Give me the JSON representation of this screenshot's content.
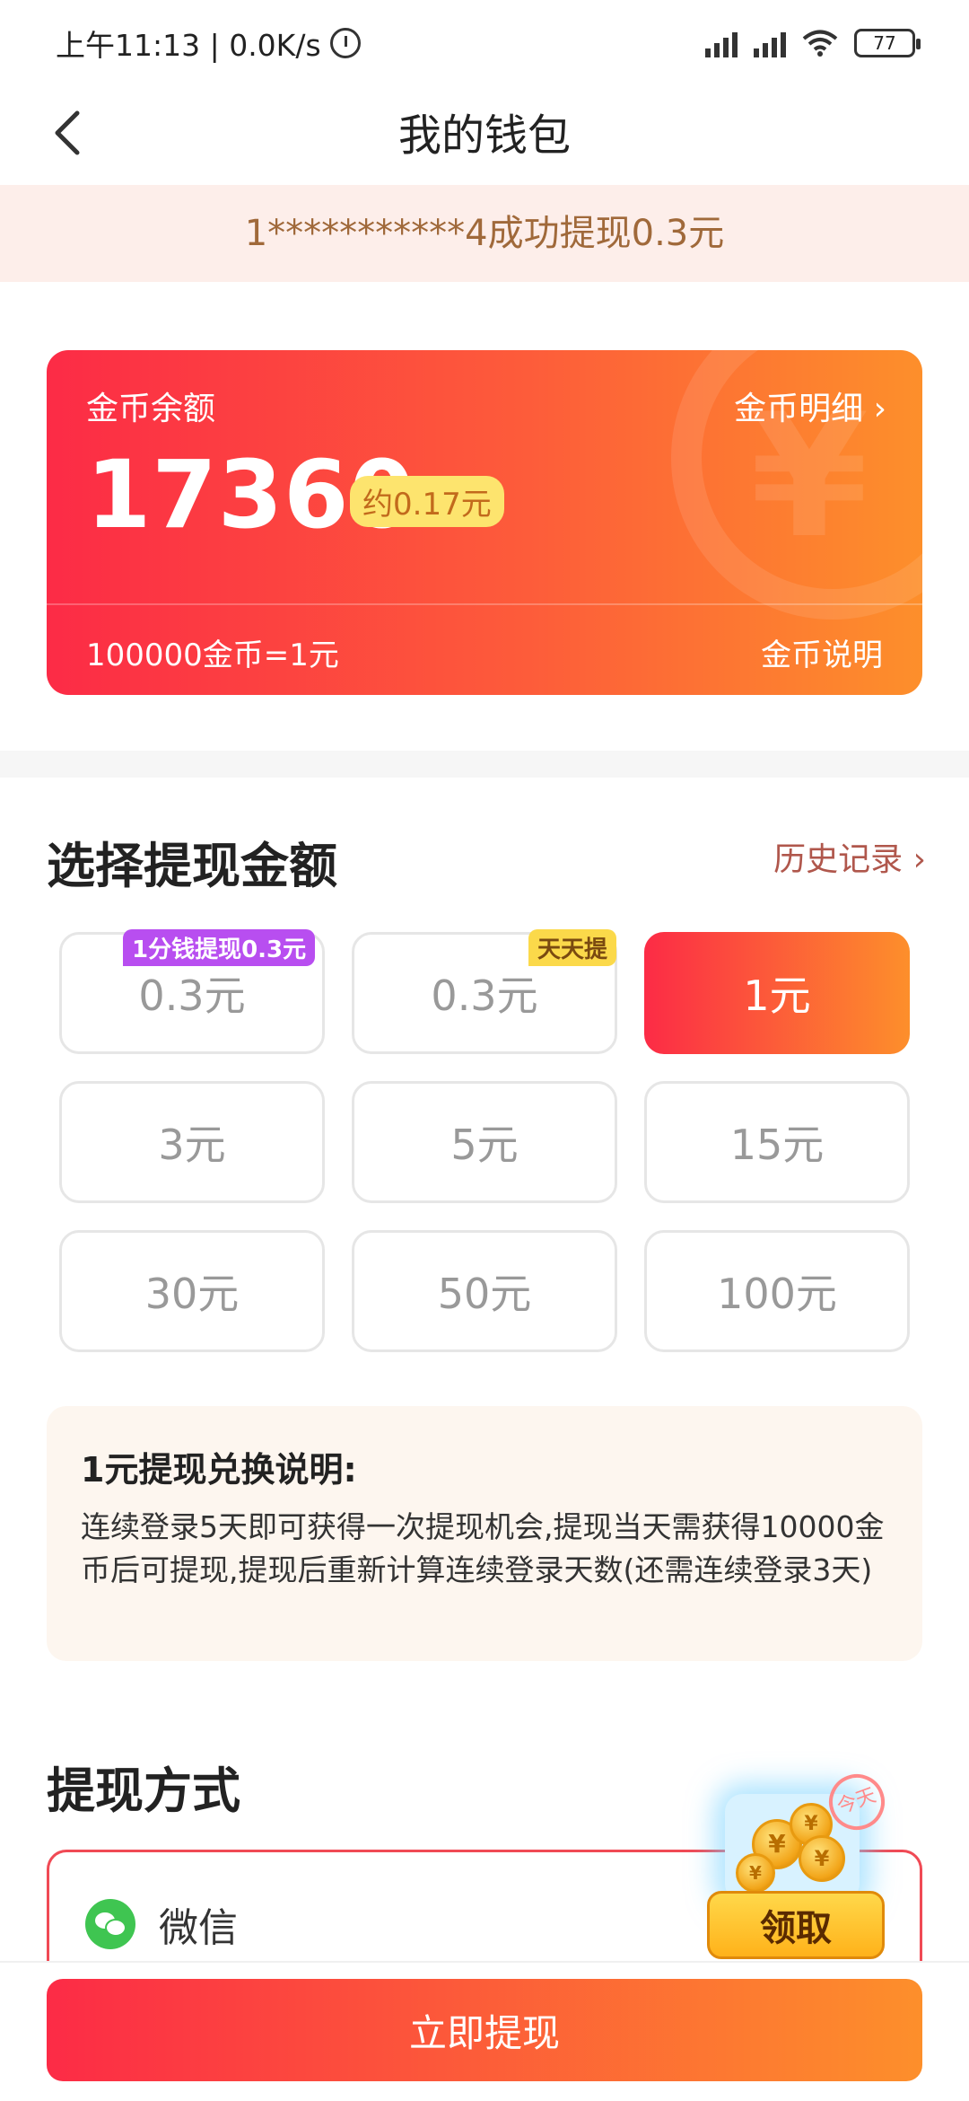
{
  "status_bar": {
    "time": "上午11:13 | 0.0K/s",
    "battery": "77",
    "icons": [
      "alarm-icon",
      "signal-icon",
      "hd-signal-icon",
      "wifi-icon",
      "battery-icon"
    ]
  },
  "nav": {
    "title": "我的钱包",
    "back_icon": "back-arrow-icon"
  },
  "notice": {
    "text": "1***********4成功提现0.3元",
    "background": "#fdeeea",
    "color": "#a0693a"
  },
  "balance_card": {
    "label": "金币余额",
    "detail_link": "金币明细 ›",
    "amount": "17360",
    "approx": "约0.17元",
    "rate": "100000金币=1元",
    "explain_link": "金币说明",
    "gradient_start": "#fc2b46",
    "gradient_end": "#fd8f2b"
  },
  "withdraw": {
    "title": "选择提现金额",
    "history_link": "历史记录 ›",
    "options": [
      {
        "label": "0.3元",
        "tag": "1分钱提现0.3元",
        "selected": false
      },
      {
        "label": "0.3元",
        "tag": "天天提",
        "selected": false
      },
      {
        "label": "1元",
        "tag": "",
        "selected": true
      },
      {
        "label": "3元",
        "tag": "",
        "selected": false
      },
      {
        "label": "5元",
        "tag": "",
        "selected": false
      },
      {
        "label": "15元",
        "tag": "",
        "selected": false
      },
      {
        "label": "30元",
        "tag": "",
        "selected": false
      },
      {
        "label": "50元",
        "tag": "",
        "selected": false
      },
      {
        "label": "100元",
        "tag": "",
        "selected": false
      }
    ]
  },
  "explanation": {
    "heading": "1元提现兑换说明:",
    "body": "连续登录5天即可获得一次提现机会,提现当天需获得10000金币后可提现,提现后重新计算连续登录天数(还需连续登录3天)"
  },
  "payment": {
    "title": "提现方式",
    "method": "微信",
    "method_icon": "wechat-icon"
  },
  "floating_reward": {
    "button": "领取",
    "stamp": "今天"
  },
  "cta": {
    "label": "立即提现"
  }
}
